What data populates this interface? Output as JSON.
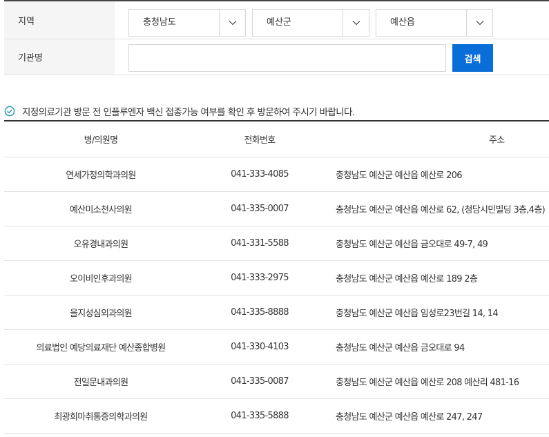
{
  "search_form": {
    "region_label": "지역",
    "region_selects": [
      {
        "value": "충청남도"
      },
      {
        "value": "예산군"
      },
      {
        "value": "예산읍"
      }
    ],
    "name_label": "기관명",
    "name_input_value": "",
    "search_button_label": "검색"
  },
  "notice": {
    "text": "지정의료기관 방문 전 인플루엔자 백신 접종가능 여부를 확인 후 방문하여 주시기 바랍니다."
  },
  "table": {
    "headers": {
      "name": "병/의원명",
      "phone": "전화번호",
      "address": "주소"
    },
    "rows": [
      {
        "name": "연세가정의학과의원",
        "phone": "041-333-4085",
        "address": "충청남도 예산군 예산읍 예산로 206"
      },
      {
        "name": "예산미소천사의원",
        "phone": "041-335-0007",
        "address": "충청남도 예산군 예산읍 예산로 62, (청담시민빌딩 3층,4층)"
      },
      {
        "name": "오유경내과의원",
        "phone": "041-331-5588",
        "address": "충청남도 예산군 예산읍 금오대로 49-7, 49"
      },
      {
        "name": "오이비인후과의원",
        "phone": "041-333-2975",
        "address": "충청남도 예산군 예산읍 예산로 189 2층"
      },
      {
        "name": "을지성심외과의원",
        "phone": "041-335-8888",
        "address": "충청남도 예산군 예산읍 임성로23번길 14, 14"
      },
      {
        "name": "의료법인 예당의료재단 예산종합병원",
        "phone": "041-330-4103",
        "address": "충청남도 예산군 예산읍 금오대로 94"
      },
      {
        "name": "전일문내과의원",
        "phone": "041-335-0087",
        "address": "충청남도 예산군 예산읍 예산로 208 예산리 481-16"
      },
      {
        "name": "최광희마취통증의학과의원",
        "phone": "041-335-5888",
        "address": "충청남도 예산군 예산읍 예산로 247, 247"
      }
    ]
  },
  "colors": {
    "primary": "#0a6ed8",
    "notice_icon": "#1a8fb0",
    "label_bg": "#f5f5f5",
    "border": "#e1e1e1"
  }
}
